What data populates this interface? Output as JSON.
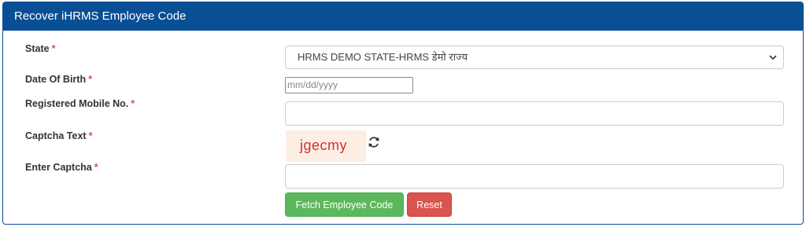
{
  "panel": {
    "title": "Recover iHRMS Employee Code"
  },
  "form": {
    "state": {
      "label": "State",
      "required": "*",
      "selected": "HRMS DEMO STATE-HRMS डेमो राज्य"
    },
    "dob": {
      "label": "Date Of Birth",
      "required": "*",
      "placeholder": "mm/dd/yyyy"
    },
    "mobile": {
      "label": "Registered Mobile No.",
      "required": "*",
      "value": ""
    },
    "captcha": {
      "label": "Captcha Text",
      "required": "*",
      "text": "jgecmy"
    },
    "enter_captcha": {
      "label": "Enter Captcha",
      "required": "*",
      "value": ""
    }
  },
  "buttons": {
    "fetch": "Fetch Employee Code",
    "reset": "Reset"
  },
  "icons": {
    "refresh": "refresh-icon",
    "dropdown": "chevron-down-icon"
  },
  "colors": {
    "header": "#0a4f95",
    "required": "#d9534f",
    "fetch_button": "#5cb85c",
    "reset_button": "#d9534f",
    "captcha_text": "#d32f2f",
    "captcha_bg": "#fdeee4"
  }
}
